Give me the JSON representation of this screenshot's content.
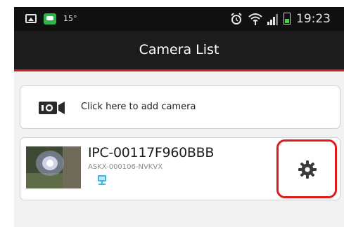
{
  "status_bar": {
    "temperature": "15°",
    "time": "19:23",
    "icons": [
      "gallery-icon",
      "chat-icon",
      "alarm-icon",
      "wifi-icon",
      "signal-icon",
      "battery-icon"
    ]
  },
  "header": {
    "title": "Camera List"
  },
  "add_camera": {
    "label": "Click here to add camera",
    "icon": "camera-add-icon"
  },
  "cameras": [
    {
      "name": "IPC-00117F960BBB",
      "uid": "ASKX-000106-NVKVX",
      "status_icon": "lan-device-icon",
      "settings_icon": "gear-icon"
    }
  ],
  "colors": {
    "status_bar_bg": "#101010",
    "title_bar_bg": "#1c1c1c",
    "accent_red": "#d21f1f",
    "highlight_red": "#e01a1a",
    "device_icon": "#3db6e6"
  }
}
